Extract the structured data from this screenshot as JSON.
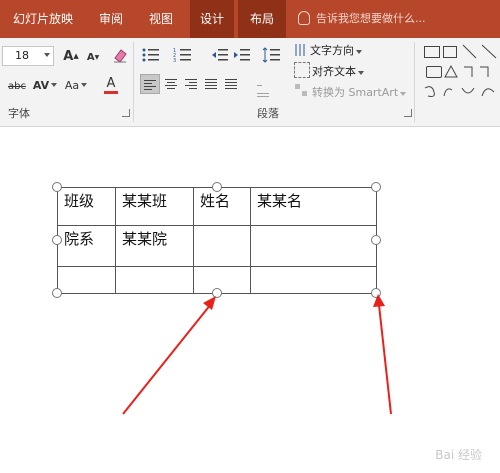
{
  "ribbon_tabs": {
    "slideshow": "幻灯片放映",
    "review": "审阅",
    "view": "视图",
    "design": "设计",
    "layout": "布局",
    "tell_me": "告诉我您想要做什么..."
  },
  "font_group": {
    "label": "字体",
    "font_size": "18",
    "grow_label": "A",
    "shrink_label": "A",
    "strike_label": "abc",
    "spacing_label": "AV",
    "case_label": "Aa",
    "font_color_label": "A",
    "font_color": "#d9302c"
  },
  "paragraph_group": {
    "label": "段落",
    "text_direction": "文字方向",
    "align_text": "对齐文本",
    "convert_smartart": "转换为 SmartArt"
  },
  "table": {
    "rows": [
      [
        "班级",
        "某某班",
        "姓名",
        "某某名"
      ],
      [
        "院系",
        "某某院",
        "",
        ""
      ],
      [
        "",
        "",
        "",
        ""
      ]
    ]
  },
  "annotation_color": "#e8211b",
  "watermark": "Bai 经验"
}
